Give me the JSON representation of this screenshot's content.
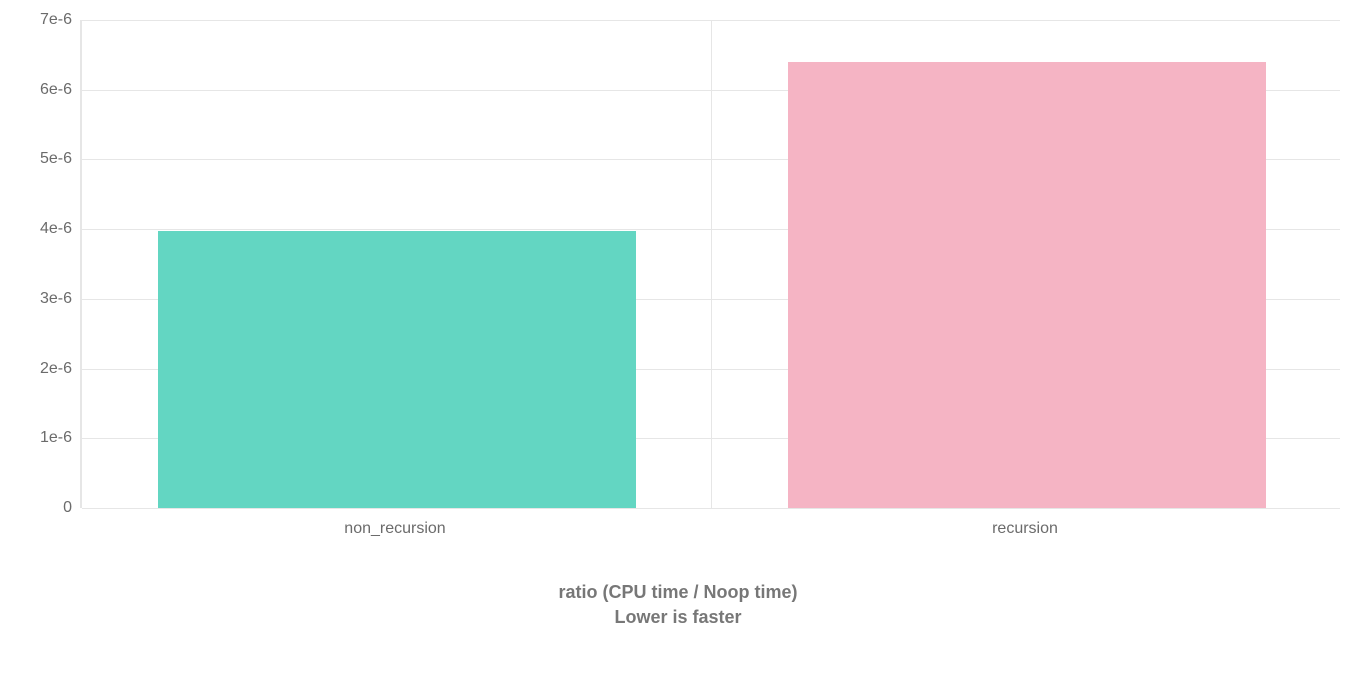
{
  "chart_data": {
    "type": "bar",
    "categories": [
      "non_recursion",
      "recursion"
    ],
    "values": [
      3.98e-06,
      6.4e-06
    ],
    "colors": [
      "#63d6c2",
      "#f5b4c4"
    ],
    "ylim": [
      0,
      7e-06
    ],
    "yticks": [
      "0",
      "1e-6",
      "2e-6",
      "3e-6",
      "4e-6",
      "5e-6",
      "6e-6",
      "7e-6"
    ],
    "caption_line1": "ratio (CPU time / Noop time)",
    "caption_line2": "Lower is faster"
  }
}
